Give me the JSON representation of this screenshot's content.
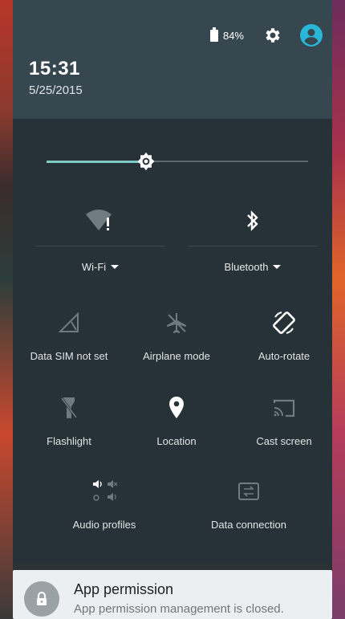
{
  "status": {
    "battery_percent": "84%",
    "battery_level": 0.84
  },
  "header": {
    "time": "15:31",
    "date": "5/25/2015"
  },
  "brightness": {
    "level": 0.38
  },
  "quick_settings": {
    "wifi": {
      "label": "Wi-Fi",
      "icon": "wifi-no-internet-icon"
    },
    "bluetooth": {
      "label": "Bluetooth",
      "icon": "bluetooth-icon"
    },
    "tiles": [
      {
        "label": "Data SIM not set",
        "icon": "signal-no-sim-icon"
      },
      {
        "label": "Airplane mode",
        "icon": "airplane-icon"
      },
      {
        "label": "Auto-rotate",
        "icon": "auto-rotate-icon"
      },
      {
        "label": "Flashlight",
        "icon": "flashlight-off-icon"
      },
      {
        "label": "Location",
        "icon": "location-pin-icon"
      },
      {
        "label": "Cast screen",
        "icon": "cast-icon"
      },
      {
        "label": "Audio profiles",
        "icon": "audio-profiles-icon"
      },
      {
        "label": "Data connection",
        "icon": "data-connection-icon"
      }
    ]
  },
  "notification": {
    "title": "App permission",
    "message": "App permission management is closed.",
    "icon": "lock-icon"
  },
  "colors": {
    "accent": "#80cbc4",
    "avatar": "#29b6d9",
    "shade": "#263238",
    "header": "#37474f"
  }
}
